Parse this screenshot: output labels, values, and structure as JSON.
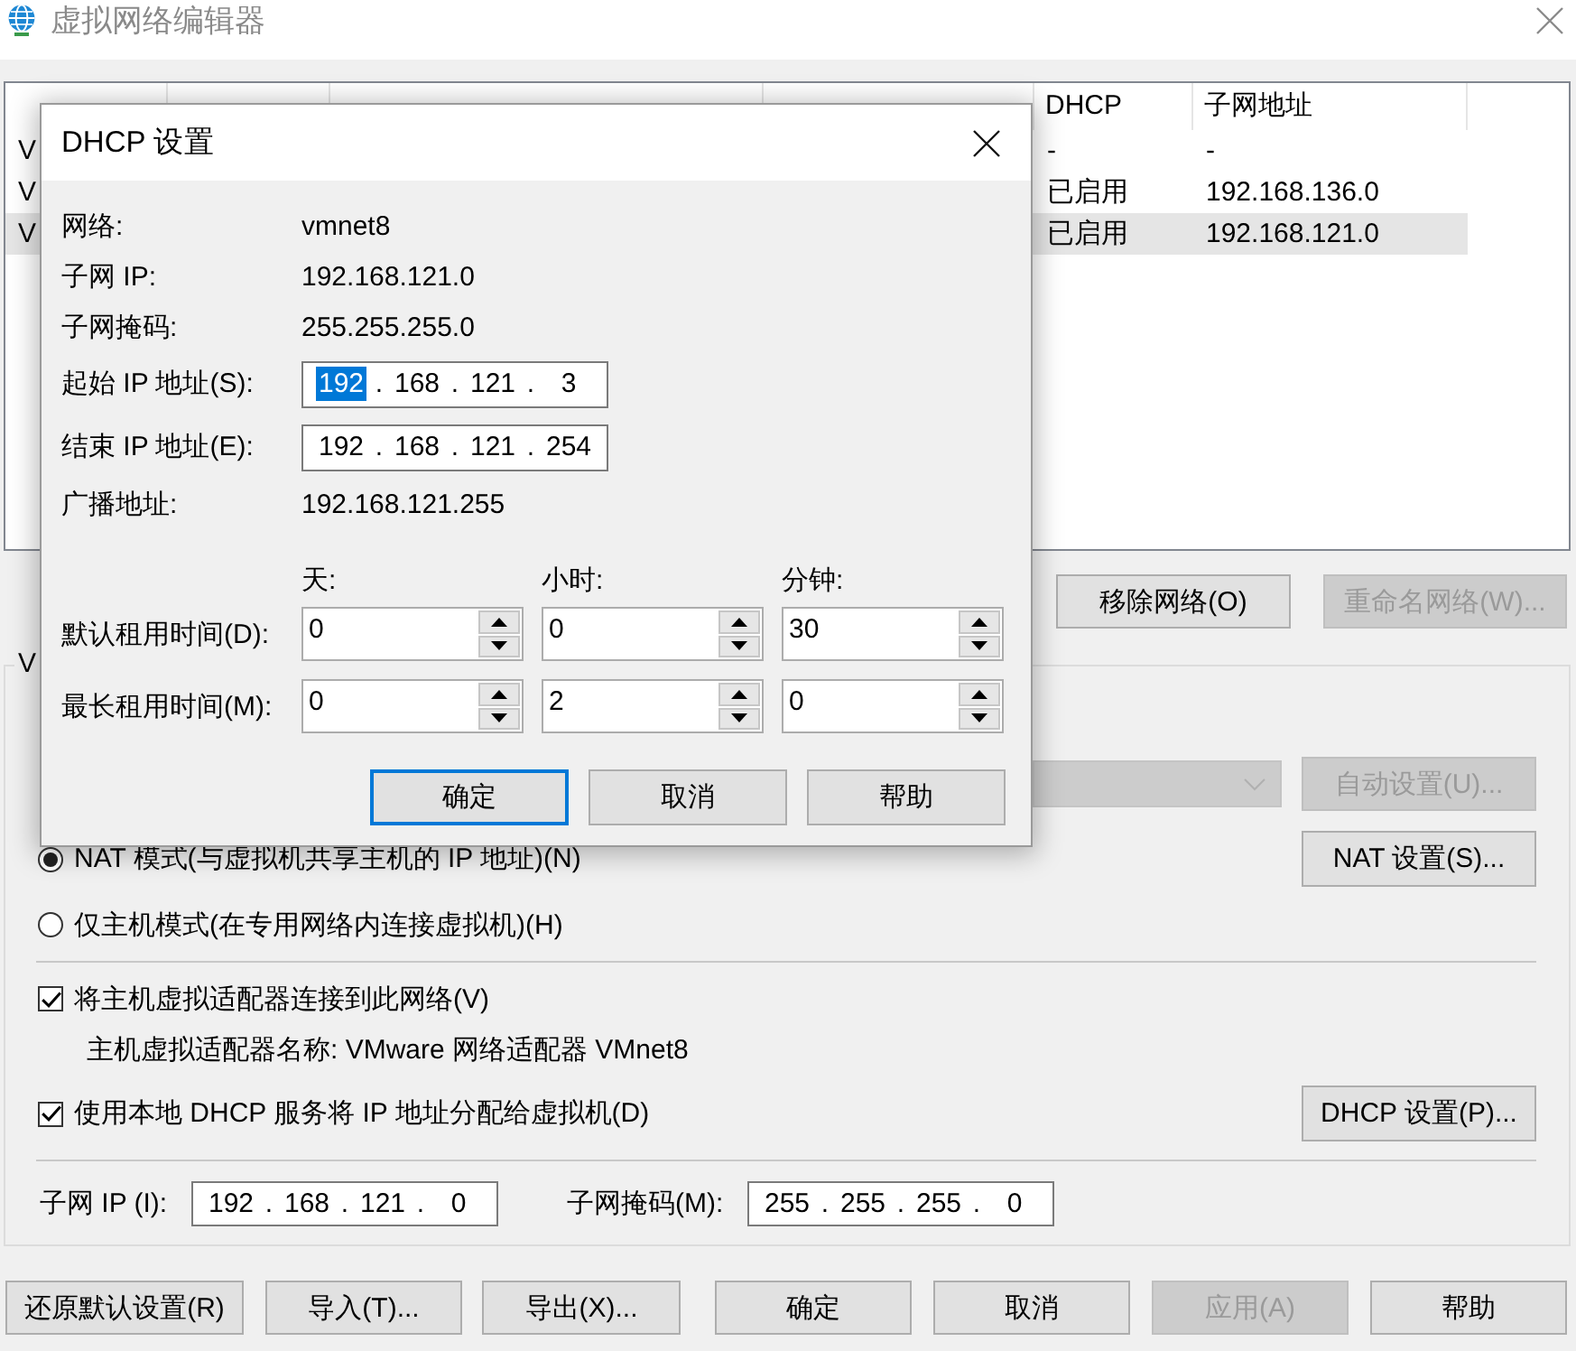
{
  "window": {
    "title": "虚拟网络编辑器"
  },
  "network_table": {
    "columns": [
      "DHCP",
      "子网地址"
    ],
    "rows": [
      {
        "column_1": "V",
        "dhcp": "-",
        "subnet_address": "-",
        "selected": false
      },
      {
        "column_1": "V",
        "dhcp": "已启用",
        "subnet_address": "192.168.136.0",
        "selected": false
      },
      {
        "column_1": "V",
        "dhcp": "已启用",
        "subnet_address": "192.168.121.0",
        "selected": true
      }
    ]
  },
  "network_buttons": [
    {
      "label": "移除网络(O)",
      "disabled": false
    },
    {
      "label": "重命名网络(W)...",
      "disabled": true
    }
  ],
  "vmnet_info": {
    "legend": "V",
    "bridged_dropdown": {
      "disabled": true
    },
    "auto_settings_button": {
      "label": "自动设置(U)...",
      "disabled": true
    },
    "modes": [
      {
        "label": "NAT 模式(与虚拟机共享主机的 IP 地址)(N)",
        "selected": true
      },
      {
        "label": "仅主机模式(在专用网络内连接虚拟机)(H)",
        "selected": false
      }
    ],
    "nat_settings_button": {
      "label": "NAT 设置(S)...",
      "disabled": false
    },
    "connect_host_adapter": {
      "label": "将主机虚拟适配器连接到此网络(V)",
      "checked": true
    },
    "host_adapter_name": "主机虚拟适配器名称: VMware 网络适配器 VMnet8",
    "use_local_dhcp": {
      "label": "使用本地 DHCP 服务将 IP 地址分配给虚拟机(D)",
      "checked": true
    },
    "dhcp_settings_button": {
      "label": "DHCP 设置(P)...",
      "disabled": false
    },
    "subnet_ip": {
      "label": "子网 IP (I):",
      "separator": ".",
      "octets": [
        {
          "text": "192",
          "selected": false
        },
        {
          "text": "168",
          "selected": false
        },
        {
          "text": "121",
          "selected": false
        },
        {
          "text": "0",
          "selected": false
        }
      ]
    },
    "subnet_mask": {
      "label": "子网掩码(M):",
      "separator": ".",
      "octets": [
        {
          "text": "255",
          "selected": false
        },
        {
          "text": "255",
          "selected": false
        },
        {
          "text": "255",
          "selected": false
        },
        {
          "text": "0",
          "selected": false
        }
      ]
    }
  },
  "footer_buttons": [
    {
      "label": "还原默认设置(R)",
      "disabled": false
    },
    {
      "label": "导入(T)...",
      "disabled": false
    },
    {
      "label": "导出(X)...",
      "disabled": false
    },
    {
      "label": "确定",
      "disabled": false
    },
    {
      "label": "取消",
      "disabled": false
    },
    {
      "label": "应用(A)",
      "disabled": true
    },
    {
      "label": "帮助",
      "disabled": false
    }
  ],
  "dhcp_dialog": {
    "title": "DHCP 设置",
    "fields": [
      {
        "kind": "text",
        "label": "网络:",
        "value": "vmnet8"
      },
      {
        "kind": "text",
        "label": "子网 IP:",
        "value": "192.168.121.0"
      },
      {
        "kind": "text",
        "label": "子网掩码:",
        "value": "255.255.255.0"
      },
      {
        "kind": "ip",
        "label": "起始 IP 地址(S):",
        "separator": ".",
        "octets": [
          {
            "text": "192",
            "selected": true
          },
          {
            "text": "168",
            "selected": false
          },
          {
            "text": "121",
            "selected": false
          },
          {
            "text": "3",
            "selected": false
          }
        ]
      },
      {
        "kind": "ip",
        "label": "结束 IP 地址(E):",
        "separator": ".",
        "octets": [
          {
            "text": "192",
            "selected": false
          },
          {
            "text": "168",
            "selected": false
          },
          {
            "text": "121",
            "selected": false
          },
          {
            "text": "254",
            "selected": false
          }
        ]
      },
      {
        "kind": "text",
        "label": "广播地址:",
        "value": "192.168.121.255"
      }
    ],
    "lease_columns": [
      "天:",
      "小时:",
      "分钟:"
    ],
    "lease_times": [
      {
        "label": "默认租用时间(D):",
        "values": [
          "0",
          "0",
          "30"
        ]
      },
      {
        "label": "最长租用时间(M):",
        "values": [
          "0",
          "2",
          "0"
        ]
      }
    ],
    "buttons": [
      {
        "label": "确定",
        "default": true
      },
      {
        "label": "取消",
        "default": false
      },
      {
        "label": "帮助",
        "default": false
      }
    ]
  }
}
